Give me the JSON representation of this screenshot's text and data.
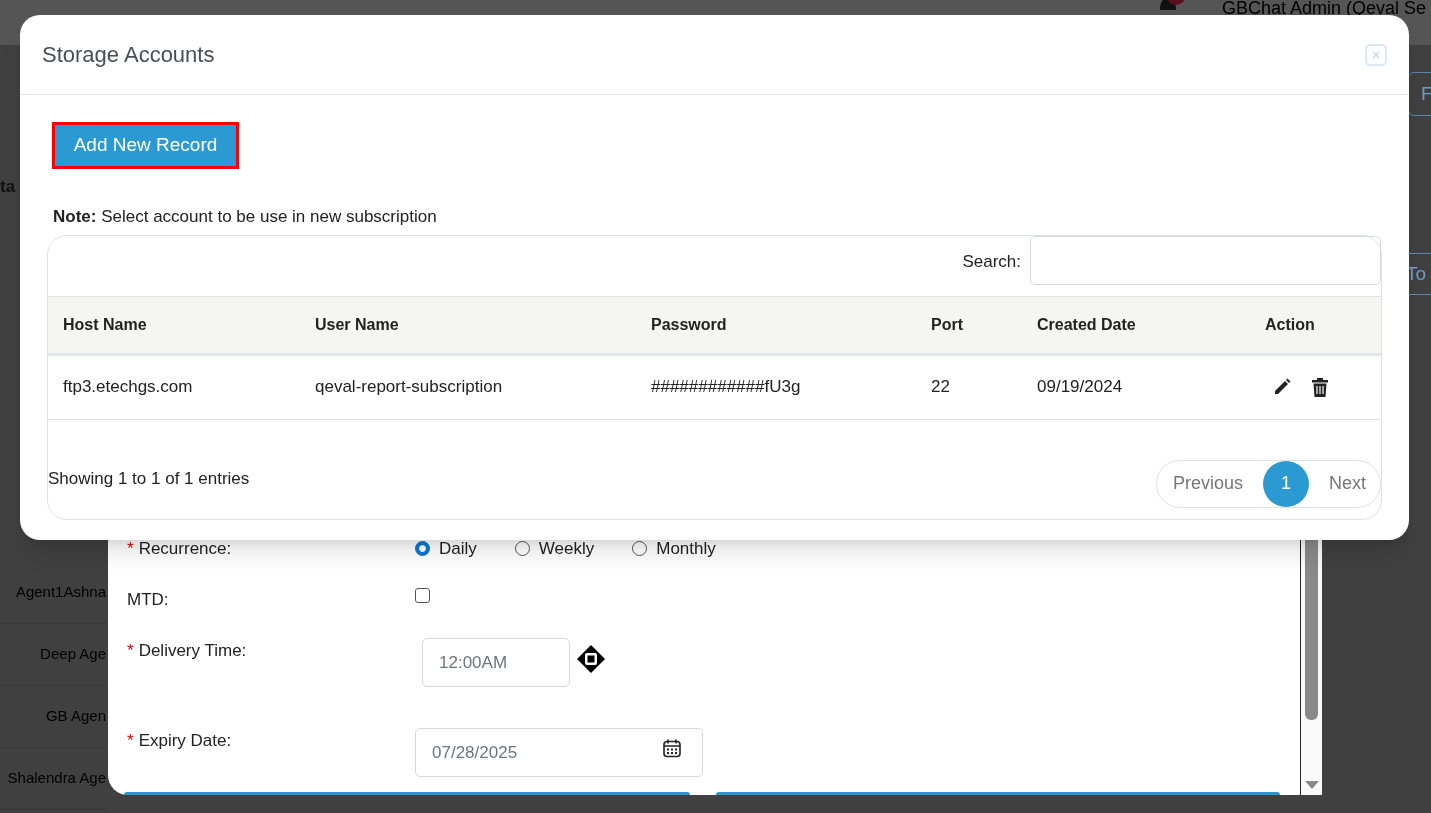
{
  "background_page": {
    "user_name": "GBChat Admin (Qeval Se",
    "heading_fragment": "ta",
    "agent_names": [
      "Agent1Ashna",
      "Deep Age",
      "GB Agen",
      "Shalendra Age"
    ],
    "right_button_fragment": "F",
    "right_link_fragment": "To"
  },
  "subscription_form": {
    "fields": [
      {
        "kind": "radio",
        "marker": "*",
        "label": "Recurrence:",
        "options": [
          {
            "label": "Daily",
            "selected": true
          },
          {
            "label": "Weekly",
            "selected": false
          },
          {
            "label": "Monthly",
            "selected": false
          }
        ]
      },
      {
        "kind": "checkbox",
        "label": "MTD:",
        "checked": false
      },
      {
        "kind": "time",
        "marker": "*",
        "label": "Delivery Time:",
        "value": "12:00AM"
      },
      {
        "kind": "date",
        "marker": "*",
        "label": "Expiry Date:",
        "value": "07/28/2025"
      }
    ]
  },
  "modal": {
    "title": "Storage Accounts",
    "add_button": "Add New Record",
    "note": "**Note:** Select account to be use in new subscription",
    "search_label": "Search:",
    "table": {
      "columns": [
        "Host Name",
        "User Name",
        "Password",
        "Port",
        "Created Date",
        "Action"
      ],
      "rows": [
        {
          "cells": [
            "ftp3.etechgs.com",
            "qeval-report-subscription",
            "############fU3g",
            "22",
            "09/19/2024"
          ]
        }
      ]
    },
    "info": "Showing 1 to 1 of 1 entries",
    "pagination": {
      "previous": "Previous",
      "pages": [
        {
          "label": "1",
          "selected": true
        }
      ],
      "next": "Next"
    }
  }
}
